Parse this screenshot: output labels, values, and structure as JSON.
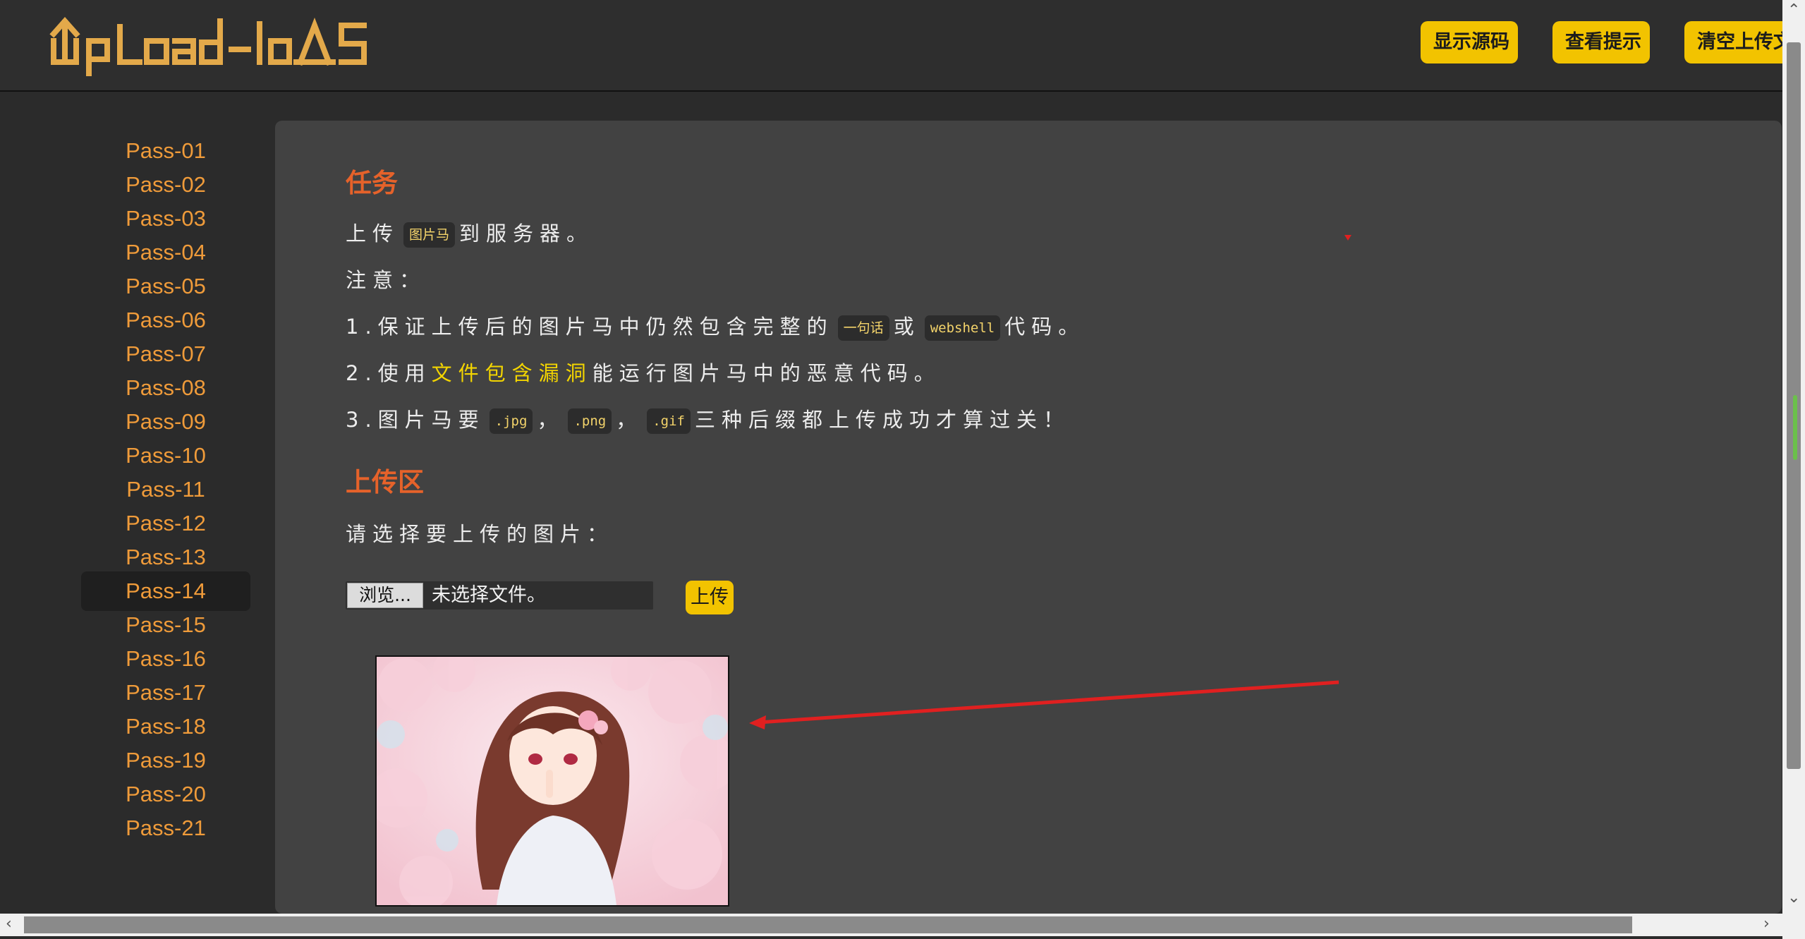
{
  "header": {
    "logo_text": "UpLoad-labS",
    "buttons": {
      "show_source": "显示源码",
      "view_hint": "查看提示",
      "clear_uploads": "清空上传文"
    }
  },
  "sidebar": {
    "items": [
      "Pass-01",
      "Pass-02",
      "Pass-03",
      "Pass-04",
      "Pass-05",
      "Pass-06",
      "Pass-07",
      "Pass-08",
      "Pass-09",
      "Pass-10",
      "Pass-11",
      "Pass-12",
      "Pass-13",
      "Pass-14",
      "Pass-15",
      "Pass-16",
      "Pass-17",
      "Pass-18",
      "Pass-19",
      "Pass-20",
      "Pass-21"
    ],
    "active": "Pass-14"
  },
  "task": {
    "title": "任务",
    "line1": {
      "pre": "上传",
      "code": "图片马",
      "post": "到服务器。"
    },
    "notice_label": "注意：",
    "item1": {
      "pre": "1.保证上传后的图片马中仍然包含完整的",
      "code1": "一句话",
      "mid": "或",
      "code2": "webshell",
      "post": "代码。"
    },
    "item2": {
      "pre": "2.使用",
      "link": "文件包含漏洞",
      "post": "能运行图片马中的恶意代码。"
    },
    "item3": {
      "pre": "3.图片马要",
      "code1": ".jpg",
      "sep1": "，",
      "code2": ".png",
      "sep2": "，",
      "code3": ".gif",
      "post": "三种后缀都上传成功才算过关！"
    }
  },
  "upload": {
    "title": "上传区",
    "prompt": "请选择要上传的图片：",
    "browse_label": "浏览...",
    "file_status": "未选择文件。",
    "submit_label": "上传"
  },
  "colors": {
    "accent_yellow": "#f2c300",
    "title_orange": "#e6622a",
    "menu_orange": "#ef9b3a",
    "annotation_red": "#e02020"
  }
}
